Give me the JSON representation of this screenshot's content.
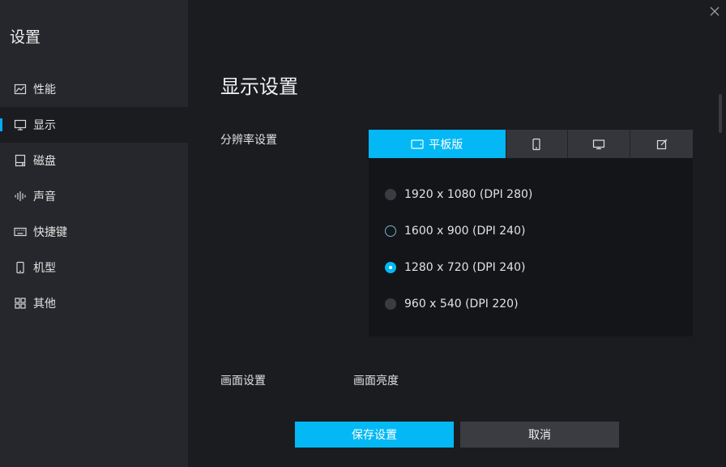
{
  "sidebar": {
    "title": "设置",
    "items": [
      {
        "label": "性能",
        "icon": "chart-icon"
      },
      {
        "label": "显示",
        "icon": "monitor-icon"
      },
      {
        "label": "磁盘",
        "icon": "disk-icon"
      },
      {
        "label": "声音",
        "icon": "sound-icon"
      },
      {
        "label": "快捷键",
        "icon": "keyboard-icon"
      },
      {
        "label": "机型",
        "icon": "phone-icon"
      },
      {
        "label": "其他",
        "icon": "grid-icon"
      }
    ],
    "active_index": 1
  },
  "main": {
    "title": "显示设置",
    "resolution": {
      "label": "分辨率设置",
      "tabs": [
        {
          "label": "平板版",
          "icon": "tablet-icon",
          "active": true
        },
        {
          "label": "",
          "icon": "phone-icon",
          "active": false
        },
        {
          "label": "",
          "icon": "monitor-icon",
          "active": false
        },
        {
          "label": "",
          "icon": "edit-icon",
          "active": false
        }
      ],
      "options": [
        {
          "label": "1920 x 1080 (DPI 280)",
          "state": "disabled"
        },
        {
          "label": "1600 x 900 (DPI 240)",
          "state": "unchecked"
        },
        {
          "label": "1280 x 720 (DPI 240)",
          "state": "checked"
        },
        {
          "label": "960 x 540 (DPI 220)",
          "state": "disabled"
        }
      ]
    },
    "picture": {
      "label": "画面设置",
      "brightness_label": "画面亮度"
    }
  },
  "footer": {
    "save_label": "保存设置",
    "cancel_label": "取消"
  },
  "colors": {
    "accent": "#03b8f5",
    "background": "#1b1c20",
    "sidebar": "#26272c"
  }
}
